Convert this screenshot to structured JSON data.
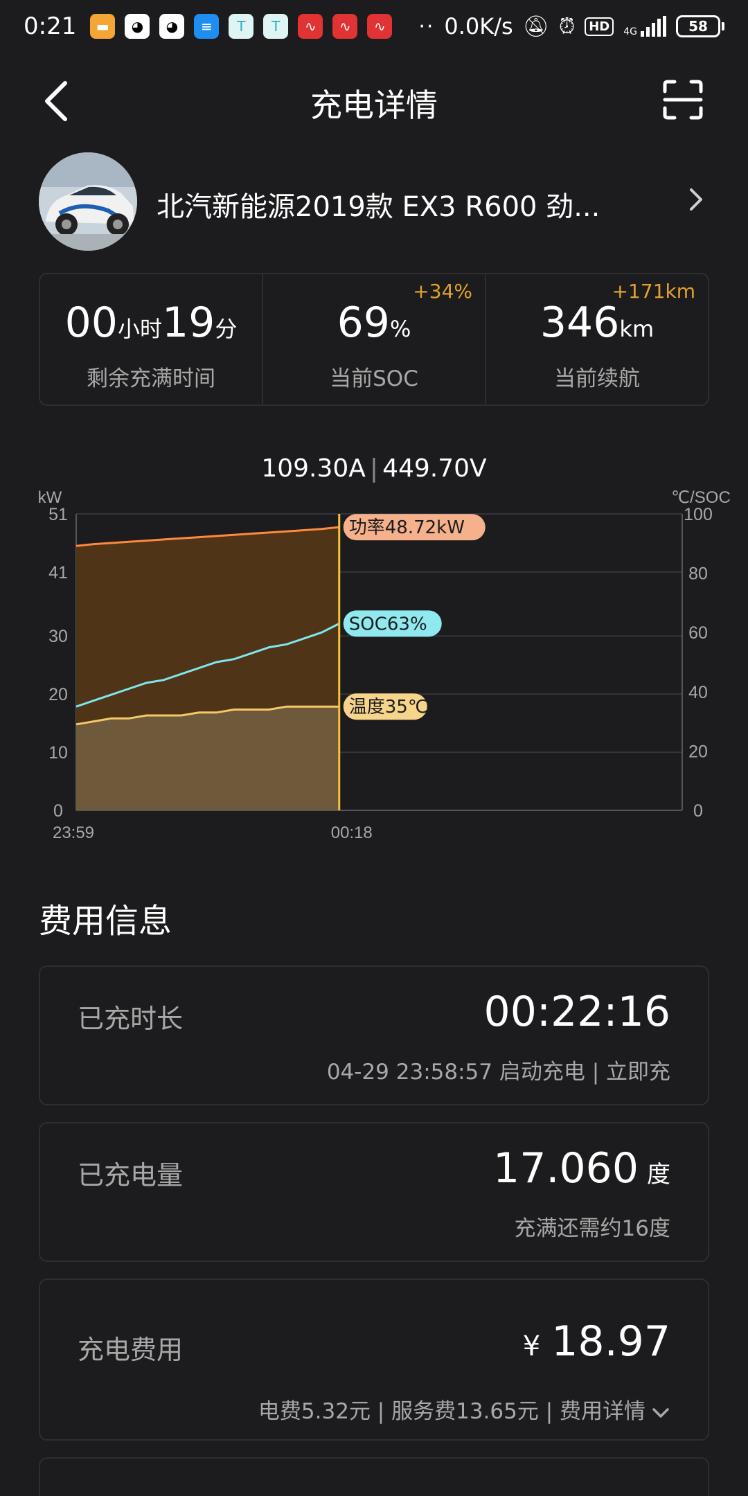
{
  "status_bar": {
    "time": "0:21",
    "dots": "··",
    "net_speed": "0.0K/s",
    "hd": "HD",
    "signal_tag": "4G",
    "battery": "58"
  },
  "header": {
    "title": "充电详情"
  },
  "car": {
    "name": "北汽新能源2019款 EX3 R600 劲..."
  },
  "stats": [
    {
      "value_a": "00",
      "unit_a": "小时",
      "value_b": "19",
      "unit_b": "分",
      "label": "剩余充满时间",
      "delta": ""
    },
    {
      "value": "69",
      "unit": "%",
      "label": "当前SOC",
      "delta": "+34%"
    },
    {
      "value": "346",
      "unit": "km",
      "label": "当前续航",
      "delta": "+171km"
    }
  ],
  "readout": {
    "current": "109.30A",
    "separator": "|",
    "voltage": "449.70V"
  },
  "chart_data": {
    "type": "area",
    "left_axis": {
      "label": "kW",
      "ticks": [
        51,
        41,
        30,
        20,
        10,
        0
      ],
      "range": [
        0,
        51
      ]
    },
    "right_axis": {
      "label": "℃/SOC",
      "ticks": [
        100,
        80,
        60,
        40,
        20,
        0
      ],
      "range": [
        0,
        100
      ]
    },
    "x_ticks": [
      "23:59",
      "00:18"
    ],
    "x_positions": [
      0,
      0.434
    ],
    "series": [
      {
        "name": "功率",
        "axis": "left",
        "color": "#ff8a3d",
        "label": "功率48.72kW",
        "values": [
          45.5,
          45.8,
          46.0,
          46.2,
          46.4,
          46.6,
          46.8,
          47.0,
          47.2,
          47.4,
          47.6,
          47.8,
          48.0,
          48.2,
          48.4,
          48.72
        ]
      },
      {
        "name": "SOC",
        "axis": "right",
        "color": "#7fe6ee",
        "label": "SOC63%",
        "values": [
          35,
          37,
          39,
          41,
          43,
          44,
          46,
          48,
          50,
          51,
          53,
          55,
          56,
          58,
          60,
          63
        ]
      },
      {
        "name": "温度",
        "axis": "right",
        "color": "#f3c96a",
        "label": "温度35℃",
        "values": [
          29,
          30,
          31,
          31,
          32,
          32,
          32,
          33,
          33,
          34,
          34,
          34,
          35,
          35,
          35,
          35
        ]
      }
    ]
  },
  "fees": {
    "section_title": "费用信息",
    "duration": {
      "label": "已充时长",
      "value": "00:22:16",
      "sub": "04-29 23:58:57 启动充电 | 立即充"
    },
    "energy": {
      "label": "已充电量",
      "value": "17.060",
      "unit": "度",
      "sub": "充满还需约16度"
    },
    "cost": {
      "label": "充电费用",
      "currency": "¥",
      "value": "18.97",
      "sub": "电费5.32元 | 服务费13.65元 | 费用详情"
    }
  }
}
